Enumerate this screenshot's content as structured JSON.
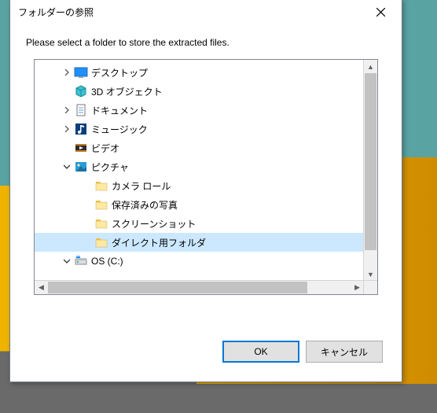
{
  "title": "フォルダーの参照",
  "prompt": "Please select a folder to store the extracted files.",
  "tree": [
    {
      "indent": 1,
      "arrow": "right",
      "icon": "desktop",
      "label": "デスクトップ",
      "selected": false
    },
    {
      "indent": 1,
      "arrow": "none",
      "icon": "objects3d",
      "label": "3D オブジェクト",
      "selected": false
    },
    {
      "indent": 1,
      "arrow": "right",
      "icon": "documents",
      "label": "ドキュメント",
      "selected": false
    },
    {
      "indent": 1,
      "arrow": "right",
      "icon": "music",
      "label": "ミュージック",
      "selected": false
    },
    {
      "indent": 1,
      "arrow": "none",
      "icon": "videos",
      "label": "ビデオ",
      "selected": false
    },
    {
      "indent": 1,
      "arrow": "down",
      "icon": "pictures",
      "label": "ピクチャ",
      "selected": false
    },
    {
      "indent": 2,
      "arrow": "none",
      "icon": "folder",
      "label": "カメラ ロール",
      "selected": false
    },
    {
      "indent": 2,
      "arrow": "none",
      "icon": "folder",
      "label": "保存済みの写真",
      "selected": false
    },
    {
      "indent": 2,
      "arrow": "none",
      "icon": "folder",
      "label": "スクリーンショット",
      "selected": false
    },
    {
      "indent": 2,
      "arrow": "none",
      "icon": "folder",
      "label": "ダイレクト用フォルダ",
      "selected": true
    },
    {
      "indent": 1,
      "arrow": "down",
      "icon": "drive",
      "label": "OS (C:)",
      "selected": false
    }
  ],
  "buttons": {
    "ok": "OK",
    "cancel": "キャンセル"
  },
  "colors": {
    "selection": "#cce8ff",
    "accent": "#0078d7"
  }
}
